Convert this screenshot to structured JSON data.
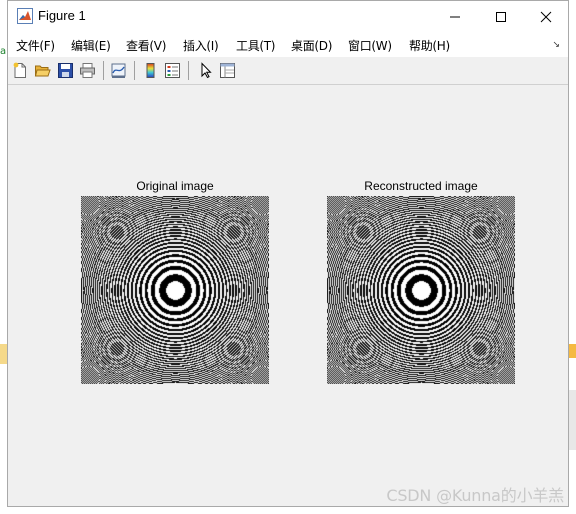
{
  "window": {
    "title": "Figure 1"
  },
  "menu": {
    "items": [
      {
        "label": "文件(F)"
      },
      {
        "label": "编辑(E)"
      },
      {
        "label": "查看(V)"
      },
      {
        "label": "插入(I)"
      },
      {
        "label": "工具(T)"
      },
      {
        "label": "桌面(D)"
      },
      {
        "label": "窗口(W)"
      },
      {
        "label": "帮助(H)"
      }
    ]
  },
  "toolbar": {
    "buttons": [
      {
        "icon": "new-figure-icon"
      },
      {
        "icon": "open-file-icon"
      },
      {
        "icon": "save-icon"
      },
      {
        "icon": "print-icon"
      },
      {
        "icon": "link-plot-icon"
      },
      {
        "icon": "insert-colorbar-icon"
      },
      {
        "icon": "insert-legend-icon"
      },
      {
        "icon": "edit-plot-icon"
      },
      {
        "icon": "property-inspector-icon"
      }
    ]
  },
  "plots": [
    {
      "title": "Original image"
    },
    {
      "title": "Reconstructed image"
    }
  ],
  "watermark": "CSDN @Kunna的小羊羔"
}
